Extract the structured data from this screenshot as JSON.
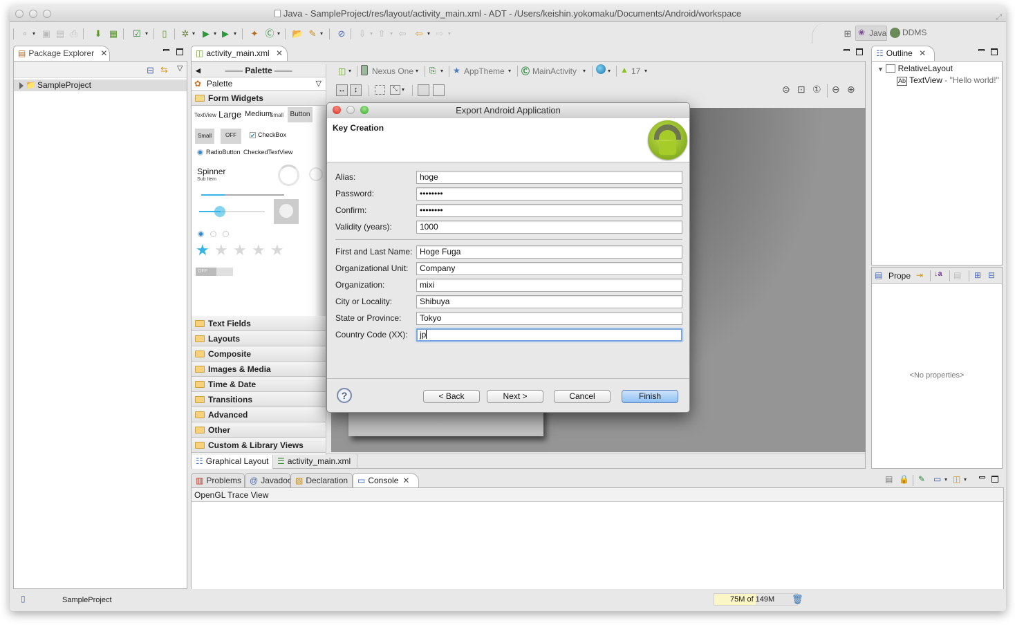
{
  "window": {
    "title": "Java - SampleProject/res/layout/activity_main.xml - ADT - /Users/keishin.yokomaku/Documents/Android/workspace"
  },
  "perspectives": {
    "java_label": "Java",
    "ddms_label": "DDMS"
  },
  "package_explorer": {
    "tab_label": "Package Explorer",
    "items": [
      {
        "label": "SampleProject"
      }
    ]
  },
  "editor": {
    "tab_label": "activity_main.xml",
    "config_bar": {
      "device": "Nexus One",
      "theme": "AppTheme",
      "activity": "MainActivity",
      "api_level": "17"
    },
    "bottom_tabs": [
      {
        "label": "Graphical Layout",
        "active": true
      },
      {
        "label": "activity_main.xml",
        "active": false
      }
    ]
  },
  "palette": {
    "header": "Palette",
    "selector": "Palette",
    "open_category": "Form Widgets",
    "widgets": {
      "textview": "TextView",
      "large": "Large",
      "medium": "Medium",
      "small": "Small",
      "button": "Button",
      "small_button": "Small",
      "toggle": "OFF",
      "checkbox": "CheckBox",
      "radio": "RadioButton",
      "checked_text": "CheckedTextView",
      "spinner": "Spinner",
      "spinner_sub": "Sub Item",
      "switch": "OFF",
      "rating": 1,
      "rating_max": 5
    },
    "categories": [
      {
        "label": "Text Fields"
      },
      {
        "label": "Layouts"
      },
      {
        "label": "Composite"
      },
      {
        "label": "Images & Media"
      },
      {
        "label": "Time & Date"
      },
      {
        "label": "Transitions"
      },
      {
        "label": "Advanced"
      },
      {
        "label": "Other"
      },
      {
        "label": "Custom & Library Views"
      }
    ]
  },
  "outline": {
    "tab_label": "Outline",
    "root": "RelativeLayout",
    "child_type": "TextView",
    "child_text": " - \"Hello world!\""
  },
  "properties": {
    "tab_label": "Prope",
    "empty": "<No properties>"
  },
  "dialog": {
    "title": "Export Android Application",
    "heading": "Key Creation",
    "fields_group1": [
      {
        "label": "Alias:",
        "value": "hoge"
      },
      {
        "label": "Password:",
        "value": "••••••••"
      },
      {
        "label": "Confirm:",
        "value": "••••••••"
      },
      {
        "label": "Validity (years):",
        "value": "1000"
      }
    ],
    "fields_group2": [
      {
        "label": "First and Last Name:",
        "value": "Hoge Fuga"
      },
      {
        "label": "Organizational Unit:",
        "value": "Company"
      },
      {
        "label": "Organization:",
        "value": "mixi"
      },
      {
        "label": "City or Locality:",
        "value": "Shibuya"
      },
      {
        "label": "State or Province:",
        "value": "Tokyo"
      },
      {
        "label": "Country Code (XX):",
        "value": "jp"
      }
    ],
    "buttons": {
      "back": "< Back",
      "next": "Next >",
      "cancel": "Cancel",
      "finish": "Finish"
    }
  },
  "bottom_panel": {
    "tabs": [
      {
        "label": "Problems"
      },
      {
        "label": "Javadoc"
      },
      {
        "label": "Declaration"
      },
      {
        "label": "Console"
      }
    ],
    "active_tab": "Console",
    "console_title": "OpenGL Trace View"
  },
  "status_bar": {
    "selected": "SampleProject",
    "heap": "75M of 149M",
    "heap_used_fraction": 0.503
  },
  "colors": {
    "focus_ring": "#7ba7e0",
    "primary_button": "#8ec0f4",
    "heap_fill": "#fbf6c5",
    "canvas_bg": "#959595"
  }
}
